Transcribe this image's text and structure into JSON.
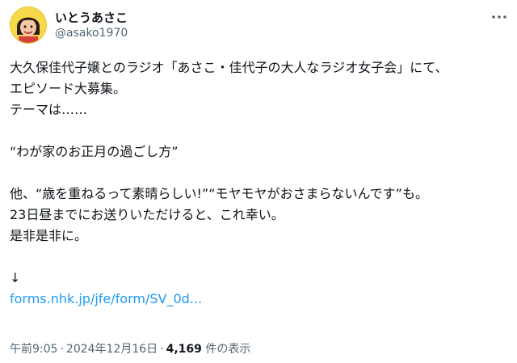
{
  "author": {
    "name": "いとうあさこ",
    "handle": "@asako1970"
  },
  "post": {
    "line1": "大久保佳代子嬢とのラジオ「あさこ・佳代子の大人なラジオ女子会」にて、",
    "line2": "エピソード大募集。",
    "line3": "テーマは……",
    "line4": "“わが家のお正月の過ごし方”",
    "line5": "他、“歳を重ねるって素晴らしい!”“モヤモヤがおさまらないんです”も。",
    "line6": "23日昼までにお送りいただけると、これ幸い。",
    "line7": "是非是非に。",
    "arrow": "↓",
    "link": "forms.nhk.jp/jfe/form/SV_0d..."
  },
  "meta": {
    "time": "午前9:05",
    "separator": "·",
    "date": "2024年12月16日",
    "views_count": "4,169",
    "views_label": "件の表示"
  },
  "icons": {
    "more": "more-horizontal-icon",
    "avatar": "avatar"
  },
  "colors": {
    "link": "#1d9bf0",
    "secondary_text": "#536471",
    "primary_text": "#0f1419"
  }
}
